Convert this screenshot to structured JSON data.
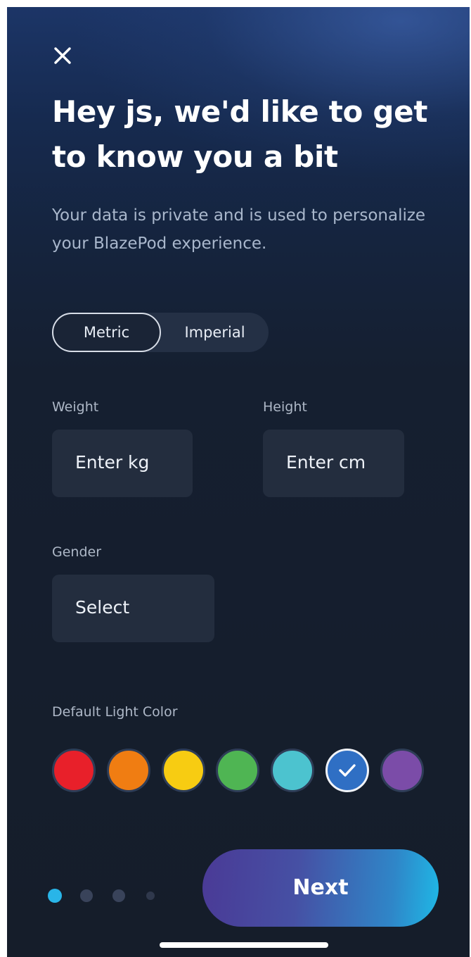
{
  "header": {
    "title": "Hey js, we'd like to get to know you a bit",
    "subtitle": "Your data is private and is used to personalize your BlazePod experience.",
    "close_icon": "close-icon"
  },
  "units": {
    "options": [
      "Metric",
      "Imperial"
    ],
    "selected": "Metric"
  },
  "weight": {
    "label": "Weight",
    "placeholder": "Enter kg"
  },
  "height": {
    "label": "Height",
    "placeholder": "Enter cm"
  },
  "gender": {
    "label": "Gender",
    "value": "Select"
  },
  "light_color": {
    "label": "Default Light Color",
    "swatches": [
      {
        "name": "red",
        "color": "#e8202a"
      },
      {
        "name": "orange",
        "color": "#f07d12"
      },
      {
        "name": "yellow",
        "color": "#f7cc12"
      },
      {
        "name": "green",
        "color": "#4fb553"
      },
      {
        "name": "cyan",
        "color": "#4cc3cf"
      },
      {
        "name": "blue",
        "color": "#2f6fc4"
      },
      {
        "name": "purple",
        "color": "#7b4ca8"
      }
    ],
    "selected": "blue"
  },
  "pagination": {
    "total_steps": 4,
    "current_step": 1
  },
  "footer": {
    "next_label": "Next"
  },
  "colors": {
    "accent": "#29b5e8",
    "background": "#151d2a",
    "input_background": "#232d3e"
  }
}
